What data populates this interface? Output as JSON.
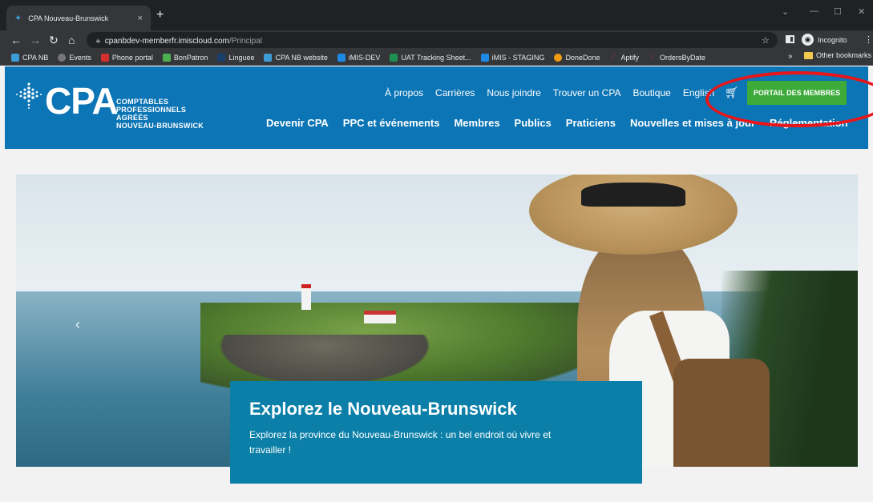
{
  "browser": {
    "tab_title": "CPA Nouveau-Brunswick",
    "tab_close": "×",
    "new_tab": "+",
    "url_host": "cpanbdev-memberfr.imiscloud.com",
    "url_path": "/Principal",
    "profile_label": "Incognito",
    "bookmarks": [
      {
        "label": "CPA NB",
        "icon_color": "#3d9bd6"
      },
      {
        "label": "Events",
        "icon_color": "#777777"
      },
      {
        "label": "Phone portal",
        "icon_color": "#d32f2f"
      },
      {
        "label": "BonPatron",
        "icon_color": "#4caf50"
      },
      {
        "label": "Linguee",
        "icon_color": "#1a3f6b"
      },
      {
        "label": "CPA NB website",
        "icon_color": "#3d9bd6"
      },
      {
        "label": "iMIS-DEV",
        "icon_color": "#1e88e5"
      },
      {
        "label": "UAT Tracking Sheet...",
        "icon_color": "#1d8f4e"
      },
      {
        "label": "iMIS - STAGING",
        "icon_color": "#1e88e5"
      },
      {
        "label": "DoneDone",
        "icon_color": "#f39c12"
      },
      {
        "label": "Aptify",
        "icon_color": "#c0392b"
      },
      {
        "label": "OrdersByDate",
        "icon_color": "#c0392b"
      }
    ],
    "bookmarks_more": "»",
    "other_bookmarks": "Other bookmarks"
  },
  "header": {
    "logo_word": "CPA",
    "logo_lines": [
      "COMPTABLES",
      "PROFESSIONNELS",
      "AGRÉÉS",
      "NOUVEAU-BRUNSWICK"
    ],
    "utility_nav": [
      "À propos",
      "Carrières",
      "Nous joindre",
      "Trouver un CPA",
      "Boutique",
      "English"
    ],
    "portal_button": "PORTAIL DES MEMBRES",
    "main_nav": [
      "Devenir CPA",
      "PPC et événements",
      "Membres",
      "Publics",
      "Praticiens",
      "Nouvelles et mises à jour",
      "Réglementation"
    ]
  },
  "hero": {
    "prev_arrow": "‹",
    "title": "Explorez le Nouveau-Brunswick",
    "text": "Explorez la province du Nouveau-Brunswick : un bel endroit où vivre et travailler !"
  },
  "colors": {
    "header_blue": "#0c75b5",
    "portal_green": "#3daa3a",
    "caption_blue": "#0b7fa8",
    "annotation_red": "#e8151a"
  }
}
